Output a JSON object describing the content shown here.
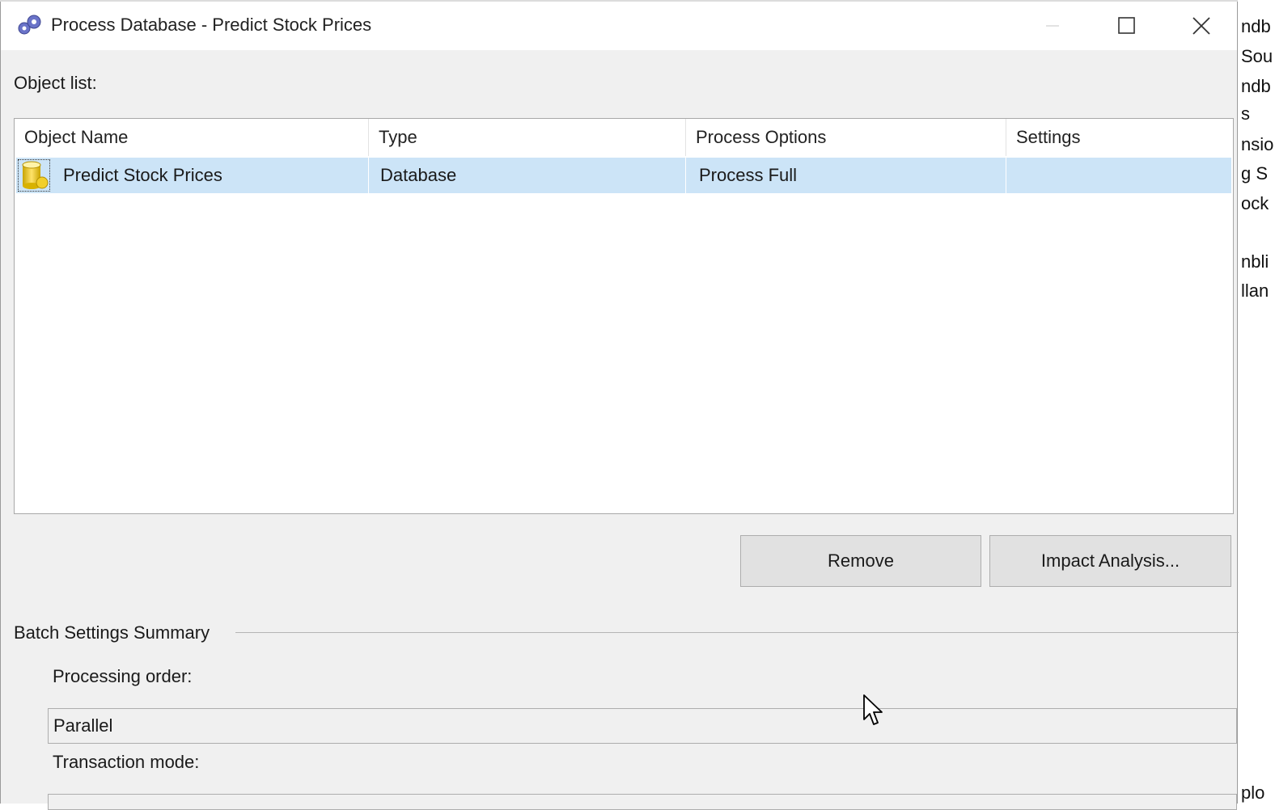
{
  "window": {
    "title": "Process Database - Predict Stock Prices",
    "icon": "process-gears-icon"
  },
  "object_list": {
    "label": "Object list:",
    "columns": [
      "Object Name",
      "Type",
      "Process Options",
      "Settings"
    ],
    "rows": [
      {
        "icon": "database-icon",
        "object_name": "Predict Stock Prices",
        "type": "Database",
        "process_options": "Process Full",
        "settings": ""
      }
    ]
  },
  "buttons": {
    "remove": "Remove",
    "impact_analysis": "Impact Analysis..."
  },
  "batch_settings": {
    "group_title": "Batch Settings Summary",
    "processing_order_label": "Processing order:",
    "processing_order_value": "Parallel",
    "transaction_mode_label": "Transaction mode:"
  },
  "background_window": {
    "fragments": [
      "ndb",
      "Sou",
      "ndb",
      "s",
      "nsio",
      "g S",
      "ock",
      "nbli",
      "llan",
      "plo"
    ]
  },
  "colors": {
    "selection": "#cce4f7",
    "dialog_bg": "#f0f0f0",
    "button_bg": "#e1e1e1"
  }
}
